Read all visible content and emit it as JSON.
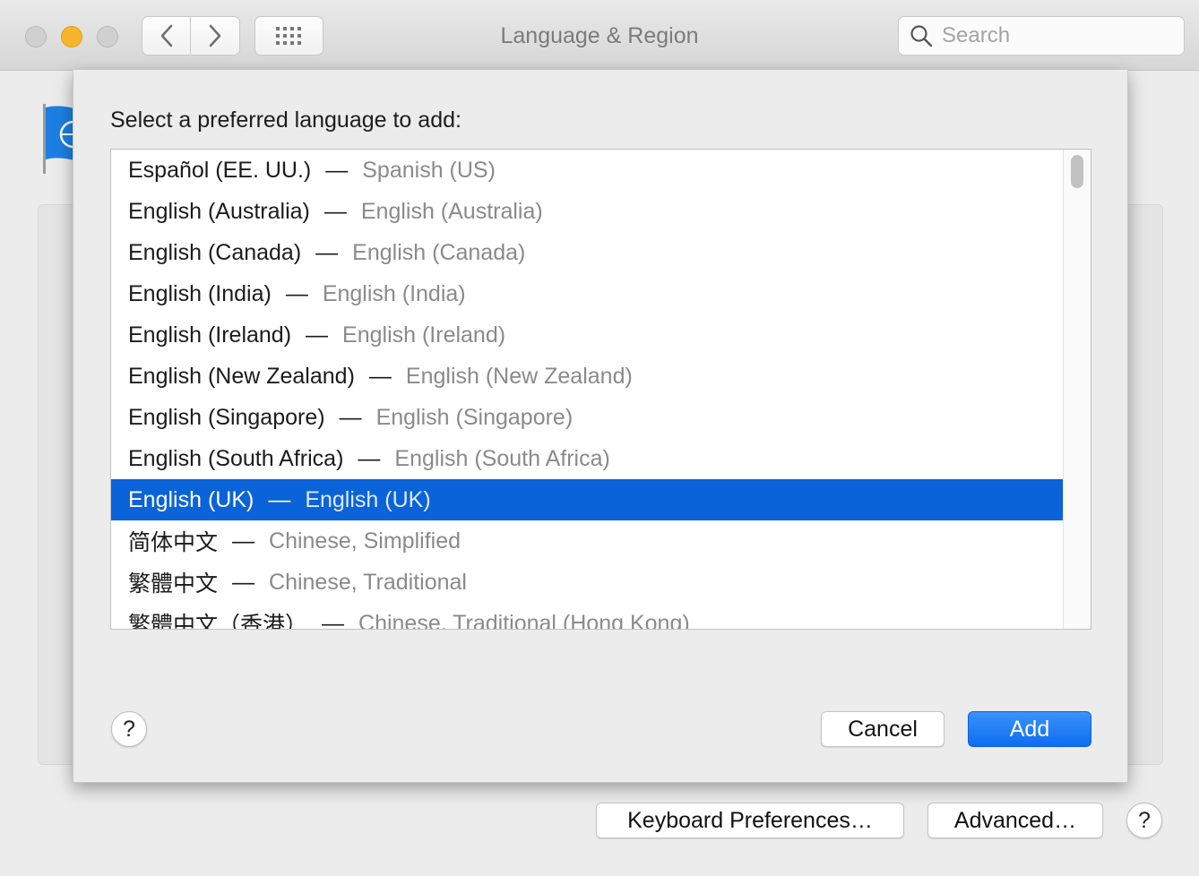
{
  "window": {
    "title": "Language & Region",
    "search_placeholder": "Search"
  },
  "colors": {
    "selection": "#0a63d8",
    "primary_button": "#1a74f3",
    "minimize": "#f7b52c"
  },
  "sheet": {
    "prompt": "Select a preferred language to add:",
    "languages": [
      {
        "native": "Español (EE. UU.)",
        "english": "Spanish (US)"
      },
      {
        "native": "English (Australia)",
        "english": "English (Australia)"
      },
      {
        "native": "English (Canada)",
        "english": "English (Canada)"
      },
      {
        "native": "English (India)",
        "english": "English (India)"
      },
      {
        "native": "English (Ireland)",
        "english": "English (Ireland)"
      },
      {
        "native": "English (New Zealand)",
        "english": "English (New Zealand)"
      },
      {
        "native": "English (Singapore)",
        "english": "English (Singapore)"
      },
      {
        "native": "English (South Africa)",
        "english": "English (South Africa)"
      },
      {
        "native": "English (UK)",
        "english": "English (UK)"
      },
      {
        "native": "简体中文",
        "english": "Chinese, Simplified"
      },
      {
        "native": "繁體中文",
        "english": "Chinese, Traditional"
      },
      {
        "native": "繁體中文（香港）",
        "english": "Chinese, Traditional (Hong Kong)"
      }
    ],
    "separator": "—",
    "selected_index": 8,
    "help_label": "?",
    "cancel_label": "Cancel",
    "add_label": "Add"
  },
  "background": {
    "keyboard_prefs_label": "Keyboard Preferences…",
    "advanced_label": "Advanced…",
    "help_label": "?"
  }
}
